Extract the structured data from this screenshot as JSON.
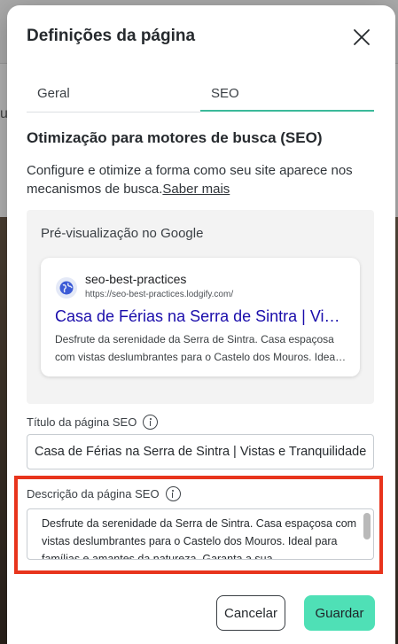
{
  "modal": {
    "title": "Definições da página"
  },
  "tabs": [
    {
      "label": "Geral",
      "active": false
    },
    {
      "label": "SEO",
      "active": true
    }
  ],
  "seo": {
    "heading": "Otimização para motores de busca (SEO)",
    "description": "Configure e otimize a forma como seu site aparece nos mecanismos de busca.",
    "learn_more": "Saber mais"
  },
  "preview": {
    "label": "Pré-visualização no Google",
    "site_name": "seo-best-practices",
    "site_url": "https://seo-best-practices.lodgify.com/",
    "title": "Casa de Férias na Serra de Sintra | Vistas e Tranquilidade",
    "description": "Desfrute da serenidade da Serra de Sintra. Casa espaçosa com vistas deslumbrantes para o Castelo dos Mouros. Ideal para famílias e amantes da natureza."
  },
  "fields": {
    "title_label": "Título da página SEO",
    "title_value": "Casa de Férias na Serra de Sintra | Vistas e Tranquilidade",
    "description_label": "Descrição da página SEO",
    "description_value": "Desfrute da serenidade da Serra de Sintra. Casa espaçosa com vistas deslumbrantes para o Castelo dos Mouros. Ideal para famílias e amantes da natureza. Garanta a sua"
  },
  "buttons": {
    "cancel": "Cancelar",
    "save": "Guardar"
  },
  "colors": {
    "accent": "#4fe0b6",
    "tab_underline": "#3bb99a",
    "link_title": "#1a0dab",
    "highlight": "#e8341c"
  },
  "icons": {
    "close": "close-icon",
    "info": "info-icon",
    "globe": "globe-icon"
  }
}
